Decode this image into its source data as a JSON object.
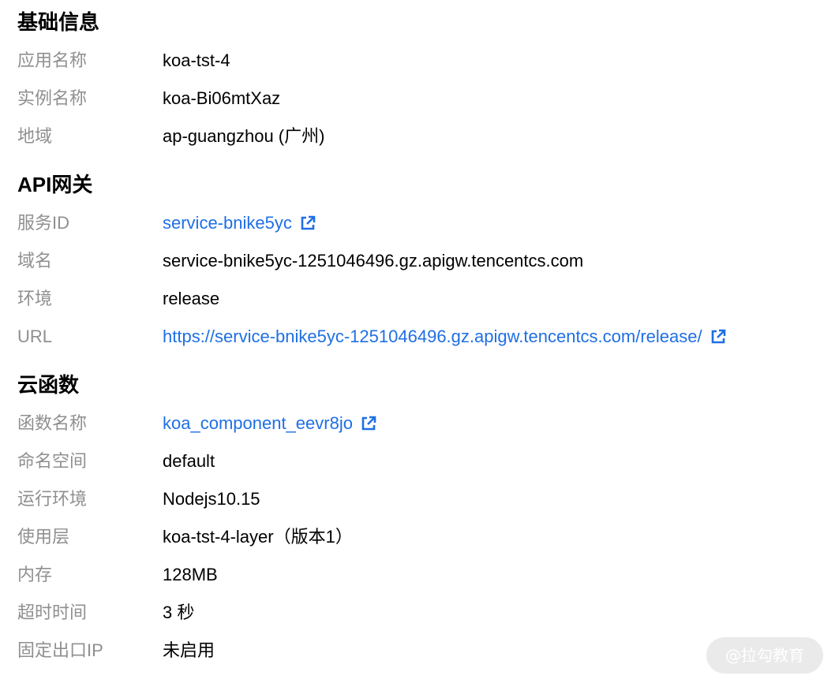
{
  "sections": [
    {
      "title": "基础信息",
      "rows": [
        {
          "label": "应用名称",
          "value": "koa-tst-4"
        },
        {
          "label": "实例名称",
          "value": "koa-Bi06mtXaz"
        },
        {
          "label": "地域",
          "value": "ap-guangzhou (广州)"
        }
      ]
    },
    {
      "title": "API网关",
      "rows": [
        {
          "label": "服务ID",
          "value": "service-bnike5yc"
        },
        {
          "label": "域名",
          "value": "service-bnike5yc-1251046496.gz.apigw.tencentcs.com"
        },
        {
          "label": "环境",
          "value": "release"
        },
        {
          "label": "URL",
          "value": "https://service-bnike5yc-1251046496.gz.apigw.tencentcs.com/release/"
        }
      ]
    },
    {
      "title": "云函数",
      "rows": [
        {
          "label": "函数名称",
          "value": "koa_component_eevr8jo"
        },
        {
          "label": "命名空间",
          "value": "default"
        },
        {
          "label": "运行环境",
          "value": "Nodejs10.15"
        },
        {
          "label": "使用层",
          "value": "koa-tst-4-layer（版本1）"
        },
        {
          "label": "内存",
          "value": "128MB"
        },
        {
          "label": "超时时间",
          "value": "3 秒"
        },
        {
          "label": "固定出口IP",
          "value": "未启用"
        }
      ]
    }
  ],
  "watermark": "@拉勾教育",
  "colors": {
    "label": "#8f8f8f",
    "value": "#000000",
    "link": "#1f6fe5"
  },
  "icons": {
    "external_link": "external-link-icon"
  }
}
